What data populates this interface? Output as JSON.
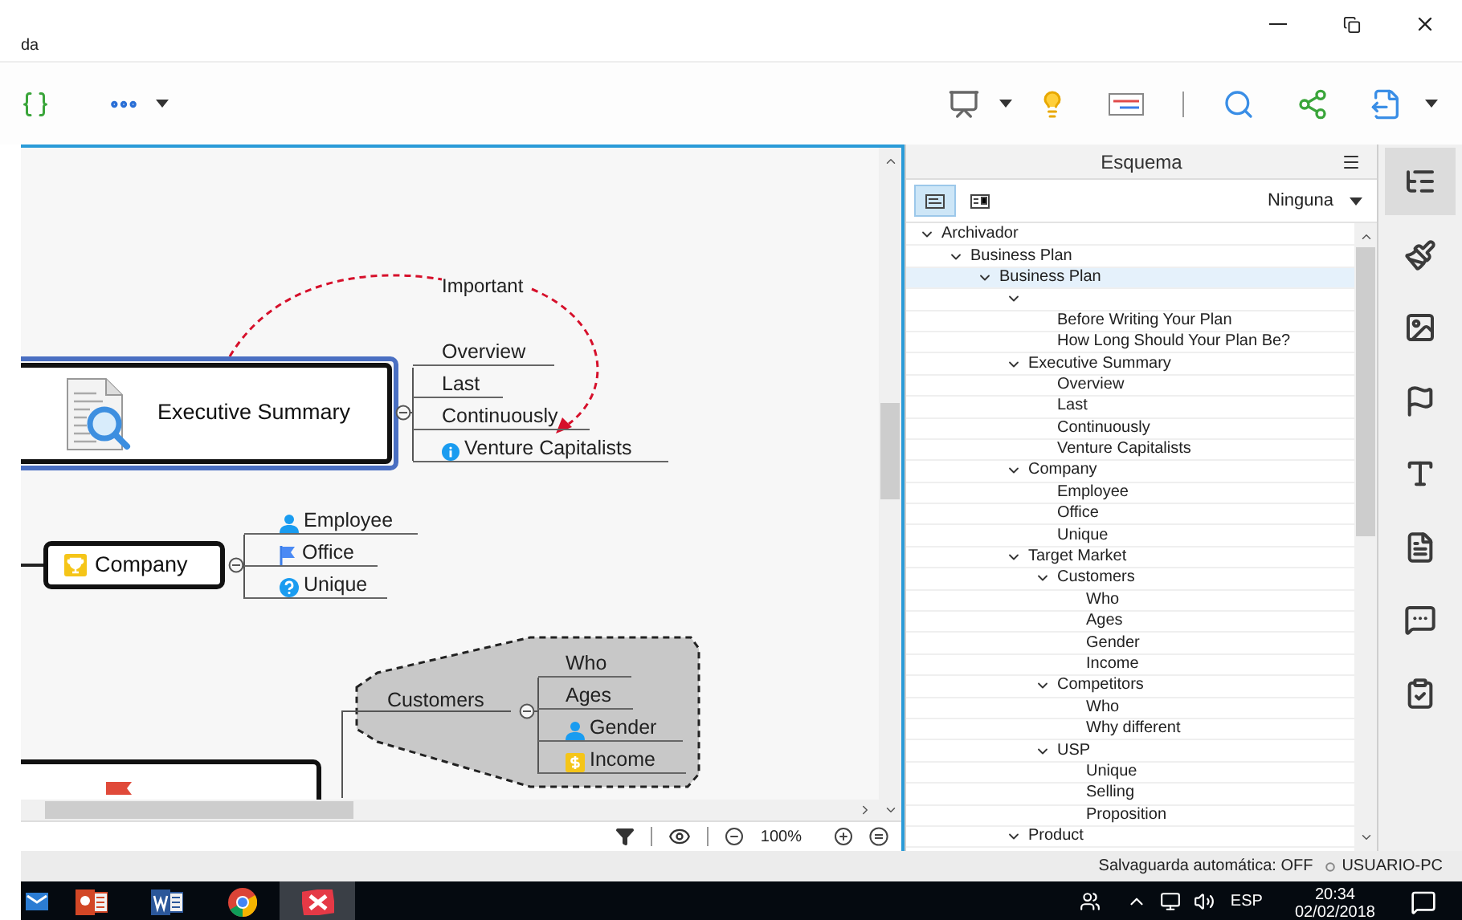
{
  "window": {
    "title": "da"
  },
  "mind_map": {
    "relationship_label": "Important",
    "executive_summary": {
      "title": "Executive Summary",
      "topics": [
        {
          "label": "Overview",
          "kind": "plain"
        },
        {
          "label": "Last",
          "kind": "plain"
        },
        {
          "label": "Continuously",
          "kind": "plain"
        },
        {
          "label": "Venture Capitalists",
          "kind": "info"
        }
      ]
    },
    "company": {
      "title": "Company",
      "topics": [
        {
          "label": "Employee",
          "kind": "person"
        },
        {
          "label": "Office",
          "kind": "flag"
        },
        {
          "label": "Unique",
          "kind": "question"
        }
      ]
    },
    "customers": {
      "title": "Customers",
      "topics": [
        {
          "label": "Who",
          "kind": "plain"
        },
        {
          "label": "Ages",
          "kind": "plain"
        },
        {
          "label": "Gender",
          "kind": "person"
        },
        {
          "label": "Income",
          "kind": "dollar"
        }
      ]
    }
  },
  "zoom": "100%",
  "outline": {
    "title": "Esquema",
    "view_modes": [
      {
        "selected": true
      },
      {
        "selected": false
      }
    ],
    "filter": "Ninguna",
    "tree": [
      {
        "label": "Archivador",
        "expanded": true,
        "selected": false,
        "children": [
          {
            "label": "Business Plan",
            "expanded": true,
            "selected": false,
            "children": [
              {
                "label": "Business Plan",
                "expanded": true,
                "selected": true,
                "children": [
                  {
                    "expanded": true,
                    "selected": false,
                    "children": [
                      {
                        "label": "Before Writing Your Plan",
                        "selected": false
                      },
                      {
                        "label": "How Long Should Your Plan Be?",
                        "selected": false
                      }
                    ]
                  },
                  {
                    "label": "Executive Summary",
                    "expanded": true,
                    "selected": false,
                    "children": [
                      {
                        "label": "Overview",
                        "selected": false
                      },
                      {
                        "label": "Last",
                        "selected": false
                      },
                      {
                        "label": "Continuously",
                        "selected": false
                      },
                      {
                        "label": "Venture Capitalists",
                        "selected": false
                      }
                    ]
                  },
                  {
                    "label": "Company",
                    "expanded": true,
                    "selected": false,
                    "children": [
                      {
                        "label": "Employee",
                        "selected": false
                      },
                      {
                        "label": "Office",
                        "selected": false
                      },
                      {
                        "label": "Unique",
                        "selected": false
                      }
                    ]
                  },
                  {
                    "label": "Target Market",
                    "expanded": true,
                    "selected": false,
                    "children": [
                      {
                        "label": "Customers",
                        "expanded": true,
                        "selected": false,
                        "children": [
                          {
                            "label": "Who",
                            "selected": false
                          },
                          {
                            "label": "Ages",
                            "selected": false
                          },
                          {
                            "label": "Gender",
                            "selected": false
                          },
                          {
                            "label": "Income",
                            "selected": false
                          }
                        ]
                      },
                      {
                        "label": "Competitors",
                        "expanded": true,
                        "selected": false,
                        "children": [
                          {
                            "label": "Who",
                            "selected": false
                          },
                          {
                            "label": "Why different",
                            "selected": false
                          }
                        ]
                      },
                      {
                        "label": "USP",
                        "expanded": true,
                        "selected": false,
                        "children": [
                          {
                            "label": "Unique",
                            "selected": false
                          },
                          {
                            "label": "Selling",
                            "selected": false
                          },
                          {
                            "label": "Proposition",
                            "selected": false
                          }
                        ]
                      }
                    ]
                  },
                  {
                    "label": "Product",
                    "expanded": true,
                    "selected": false
                  }
                ]
              }
            ]
          }
        ]
      }
    ]
  },
  "sidebar_tabs": [
    {
      "kind": "outline",
      "selected": true
    },
    {
      "kind": "style",
      "selected": false
    },
    {
      "kind": "image",
      "selected": false
    },
    {
      "kind": "marker",
      "selected": false
    },
    {
      "kind": "text",
      "selected": false
    },
    {
      "kind": "notes",
      "selected": false
    },
    {
      "kind": "comments",
      "selected": false
    },
    {
      "kind": "task",
      "selected": false
    }
  ],
  "status_bar": {
    "autosave": "Salvaguarda automática: OFF",
    "user": "USUARIO-PC"
  },
  "taskbar": {
    "apps": [
      {
        "kind": "mail",
        "selected": false
      },
      {
        "kind": "powerpoint",
        "selected": false
      },
      {
        "kind": "word",
        "selected": false
      },
      {
        "kind": "chrome",
        "selected": false
      },
      {
        "kind": "xmind",
        "selected": true
      }
    ],
    "language": "ESP",
    "time": "20:34",
    "date": "02/02/2018"
  }
}
